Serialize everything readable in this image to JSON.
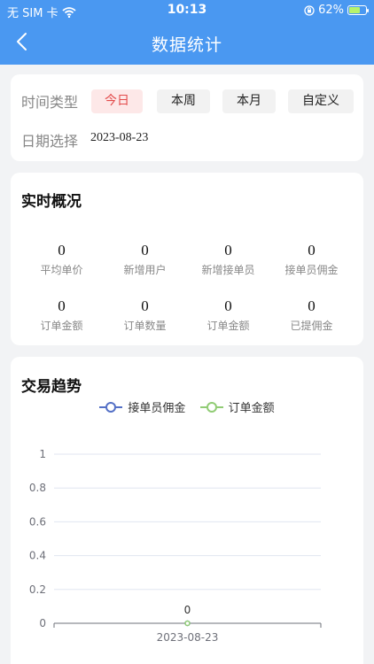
{
  "status": {
    "carrier": "无 SIM 卡",
    "time": "10:13",
    "battery": "62%"
  },
  "header": {
    "title": "数据统计"
  },
  "filter": {
    "time_type_label": "时间类型",
    "options": [
      "今日",
      "本周",
      "本月",
      "自定义"
    ],
    "selected": "今日",
    "date_label": "日期选择",
    "date_value": "2023-08-23"
  },
  "overview": {
    "title": "实时概况",
    "stats": [
      {
        "value": "0",
        "label": "平均单价"
      },
      {
        "value": "0",
        "label": "新增用户"
      },
      {
        "value": "0",
        "label": "新增接单员"
      },
      {
        "value": "0",
        "label": "接单员佣金"
      },
      {
        "value": "0",
        "label": "订单金额"
      },
      {
        "value": "0",
        "label": "订单数量"
      },
      {
        "value": "0",
        "label": "订单金额"
      },
      {
        "value": "0",
        "label": "已提佣金"
      }
    ]
  },
  "trend": {
    "title": "交易趋势",
    "colors": {
      "series1": "#5470c6",
      "series2": "#91cc75"
    }
  },
  "chart_data": {
    "type": "line",
    "categories": [
      "2023-08-23"
    ],
    "series": [
      {
        "name": "接单员佣金",
        "values": [
          0
        ]
      },
      {
        "name": "订单金额",
        "values": [
          0
        ]
      }
    ],
    "yticks": [
      "1",
      "0.8",
      "0.6",
      "0.4",
      "0.2",
      "0"
    ],
    "ylim": [
      0,
      1
    ],
    "data_labels": [
      "0"
    ],
    "legend": "top",
    "grid": true
  }
}
